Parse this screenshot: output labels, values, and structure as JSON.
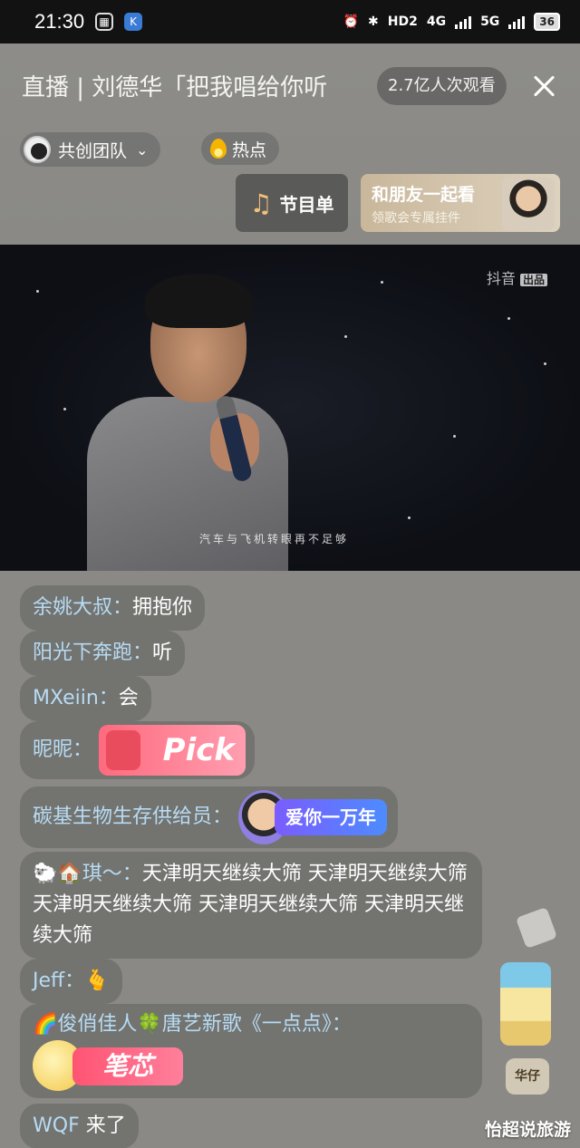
{
  "status_bar": {
    "time": "21:30",
    "network_badge": "HD2",
    "sig1": "4G",
    "sig2": "5G",
    "battery": "36"
  },
  "header": {
    "title": "直播 |  刘德华「把我唱给你听",
    "viewers": "2.7亿人次观看",
    "team_label": "共创团队",
    "hot_label": "热点",
    "program_label": "节目单",
    "watch_title": "和朋友一起看",
    "watch_sub": "领歌会专属挂件"
  },
  "video": {
    "watermark_prefix": "抖音",
    "watermark_badge": "出品",
    "subtitle": "汽车与飞机转眼再不足够"
  },
  "comments": [
    {
      "nick": "余姚大叔：",
      "text": "拥抱你"
    },
    {
      "nick": "阳光下奔跑：",
      "text": "听"
    },
    {
      "nick": "MXeiin：",
      "text": "会"
    },
    {
      "nick": "昵昵：",
      "text": "",
      "gift": "Pick"
    },
    {
      "nick": "碳基生物生存供给员：",
      "text": "",
      "gift": "爱你一万年"
    },
    {
      "emoji": "🐑🏠",
      "nick": "琪～：",
      "text": "天津明天继续大筛 天津明天继续大筛 天津明天继续大筛 天津明天继续大筛 天津明天继续大筛"
    },
    {
      "nick": "Jeff：",
      "text": "",
      "emoji_tail": "🫰"
    },
    {
      "emoji": "🌈",
      "nick": "俊俏佳人",
      "emoji_mid": "🍀",
      "nick2": "唐艺新歌《一点点》：",
      "gift": "笔芯"
    },
    {
      "nick": "WQF",
      "text": "来了"
    }
  ],
  "side": {
    "badge": "华仔"
  },
  "footer_watermark": "怡超说旅游"
}
